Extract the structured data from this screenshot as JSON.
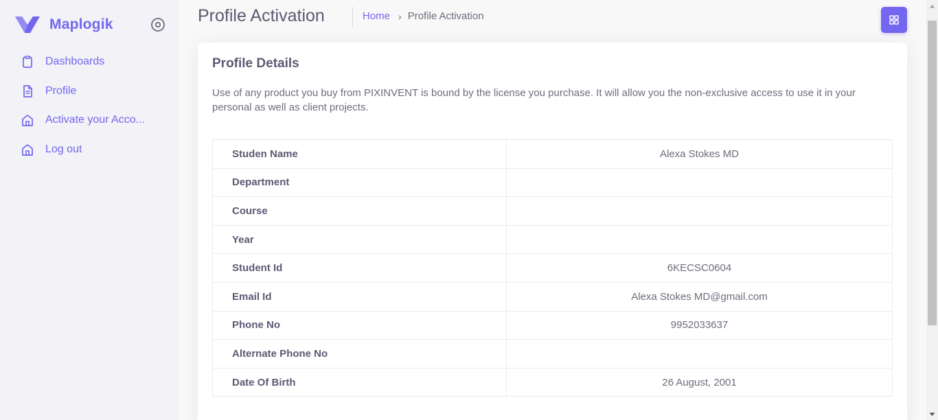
{
  "sidebar": {
    "brand": "Maplogik",
    "items": [
      {
        "label": "Dashboards",
        "icon": "clipboard-icon"
      },
      {
        "label": "Profile",
        "icon": "file-text-icon"
      },
      {
        "label": "Activate your Acco...",
        "icon": "home-icon"
      },
      {
        "label": "Log out",
        "icon": "home-icon"
      }
    ]
  },
  "header": {
    "title": "Profile Activation",
    "breadcrumb": {
      "home": "Home",
      "separator": "›",
      "current": "Profile Activation"
    }
  },
  "card": {
    "title": "Profile Details",
    "text": "Use of any product you buy from PIXINVENT is bound by the license you purchase. It will allow you the non-exclusive access to use it in your personal as well as client projects.",
    "rows": [
      {
        "label": "Studen Name",
        "value": "Alexa Stokes MD"
      },
      {
        "label": "Department",
        "value": ""
      },
      {
        "label": "Course",
        "value": ""
      },
      {
        "label": "Year",
        "value": ""
      },
      {
        "label": "Student Id",
        "value": "6KECSC0604"
      },
      {
        "label": "Email Id",
        "value": "Alexa Stokes MD@gmail.com"
      },
      {
        "label": "Phone No",
        "value": "9952033637"
      },
      {
        "label": "Alternate Phone No",
        "value": ""
      },
      {
        "label": "Date Of Birth",
        "value": "26 August, 2001"
      }
    ]
  },
  "colors": {
    "primary": "#7367f0",
    "heading": "#5e5873",
    "body": "#6e6b7b"
  }
}
